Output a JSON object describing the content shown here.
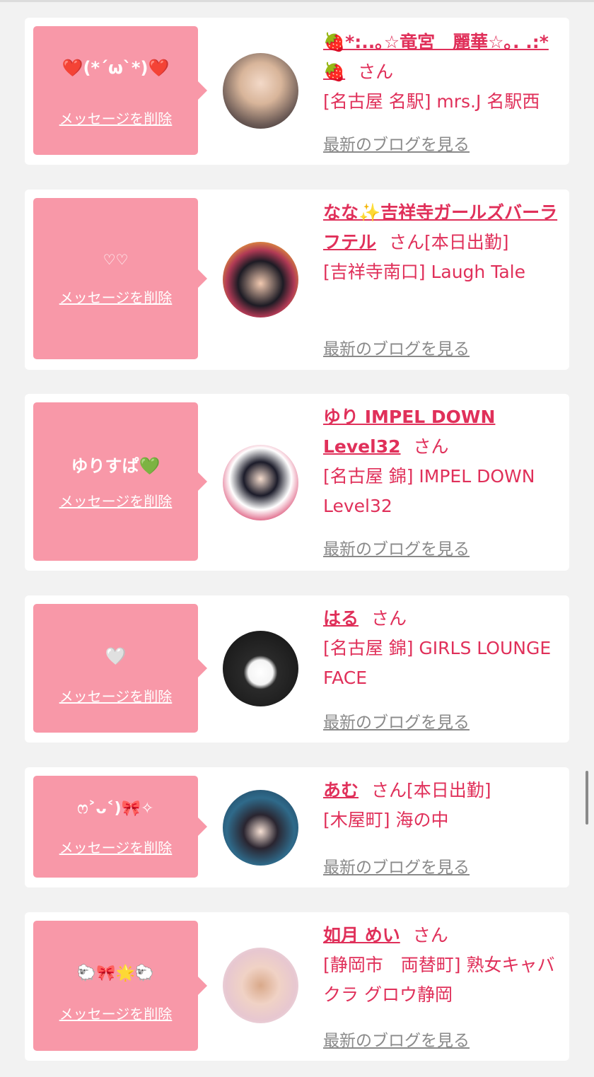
{
  "delete_label": "メッセージを削除",
  "blog_label": "最新のブログを見る",
  "san_label": "さん",
  "colors": {
    "background": "#f2f2f2",
    "bubble": "#f898a8",
    "accent": "#e0305a",
    "link_gray": "#8a8a8a"
  },
  "entries": [
    {
      "message": "❤️(*´ω`*)❤️",
      "name": "🍓*:..｡☆竜宮　麗華☆｡. .:*🍓",
      "status": "",
      "shop": "[名古屋 名駅] mrs.J 名駅西"
    },
    {
      "message": "♡♡",
      "name": "なな✨吉祥寺ガールズバーラフテル",
      "status": "[本日出勤]",
      "shop": "[吉祥寺南口] Laugh Tale"
    },
    {
      "message": "ゆりすぱ💚",
      "name": "ゆり IMPEL DOWN Level32",
      "status": "",
      "shop": "[名古屋 錦] IMPEL DOWN Level32"
    },
    {
      "message": "🤍",
      "name": "はる",
      "status": "",
      "shop": "[名古屋 錦] GIRLS LOUNGE FACE"
    },
    {
      "message": "ෆ˃ᴗ˂)🎀✧",
      "name": "あむ",
      "status": "[本日出勤]",
      "shop": "[木屋町] 海の中"
    },
    {
      "message": "🐑🎀🌟🐑",
      "name": "如月 めい",
      "status": "",
      "shop": "[静岡市　両替町] 熟女キャバクラ グロウ静岡"
    }
  ]
}
